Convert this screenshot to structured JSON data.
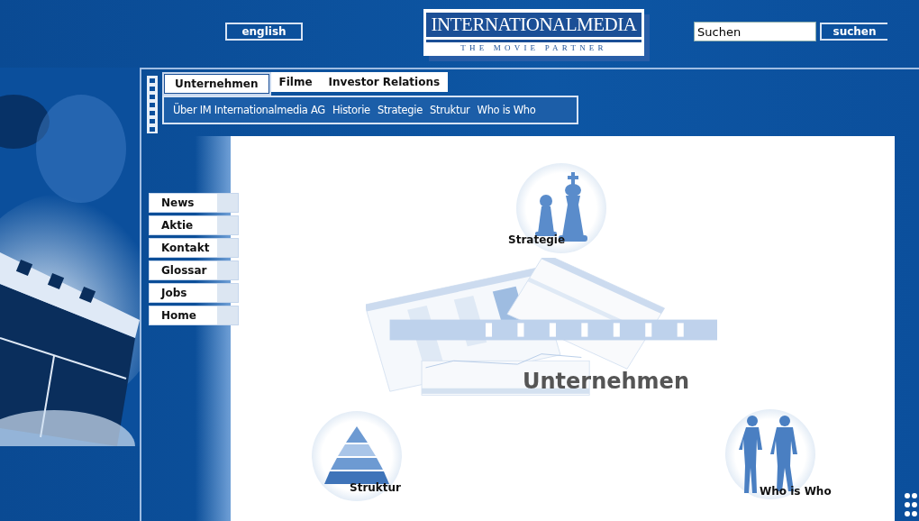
{
  "header": {
    "language_button": "english",
    "logo": {
      "title": "INTERNATIONALMEDIA",
      "subtitle": "THE MOVIE PARTNER"
    },
    "search": {
      "value": "Suchen",
      "button": "suchen"
    }
  },
  "tabs": [
    {
      "label": "Unternehmen",
      "selected": true
    },
    {
      "label": "Filme",
      "selected": false
    },
    {
      "label": "Investor Relations",
      "selected": false
    }
  ],
  "subnav": [
    "Über IM Internationalmedia AG",
    "Historie",
    "Strategie",
    "Struktur",
    "Who is Who"
  ],
  "side_nav": [
    "News",
    "Aktie",
    "Kontakt",
    "Glossar",
    "Jobs",
    "Home"
  ],
  "content": {
    "heading": "Unternehmen",
    "items": [
      {
        "kind": "chess",
        "label": "Strategie"
      },
      {
        "kind": "pyramid",
        "label": "Struktur"
      },
      {
        "kind": "people",
        "label": "Who is Who"
      }
    ]
  }
}
